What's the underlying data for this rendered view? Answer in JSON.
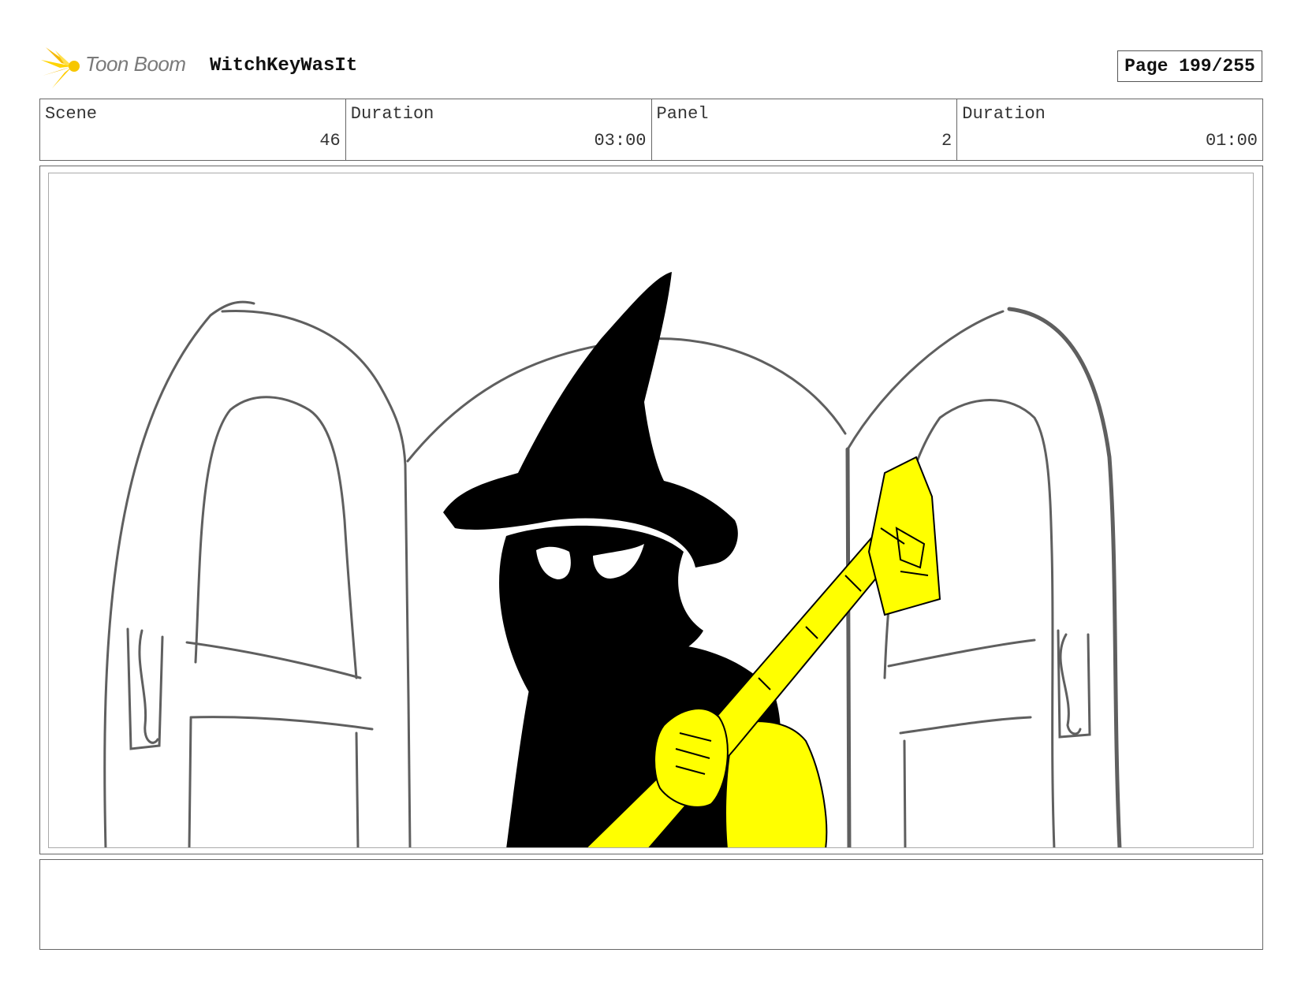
{
  "header": {
    "logo_text": "Toon Boom",
    "project_title": "WitchKeyWasIt",
    "page_label": "Page 199/255"
  },
  "info": {
    "scene_label": "Scene",
    "scene_value": "46",
    "scene_duration_label": "Duration",
    "scene_duration_value": "03:00",
    "panel_label": "Panel",
    "panel_value": "2",
    "panel_duration_label": "Duration",
    "panel_duration_value": "01:00"
  },
  "panel": {
    "description": "",
    "colors": {
      "sketch_line": "#5f5f5f",
      "silhouette": "#000000",
      "highlight": "#ffff00"
    }
  },
  "notes": {
    "text": ""
  }
}
